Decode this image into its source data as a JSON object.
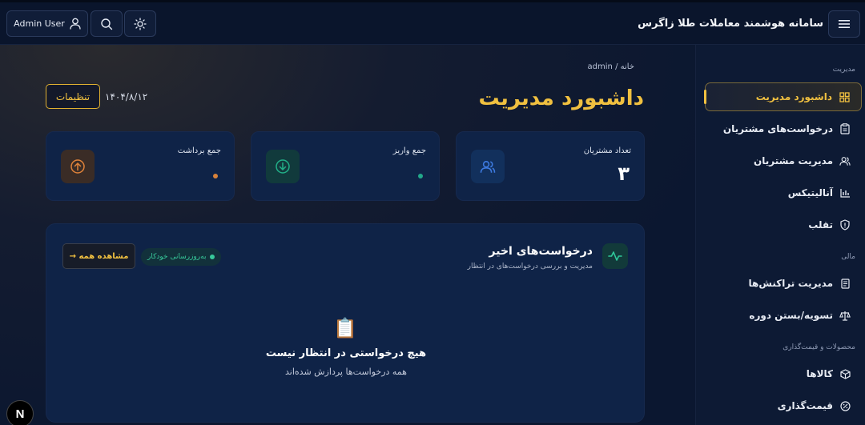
{
  "header": {
    "app_title": "سامانه هوشمند معاملات طلا زاگرس",
    "user_label": "Admin User"
  },
  "sidebar": {
    "sections": [
      {
        "label": "مدیریت"
      },
      {
        "label": "مالی"
      },
      {
        "label": "محصولات و قیمت‌گذاری"
      }
    ],
    "items": [
      {
        "label": "داشبورد مدیریت",
        "icon": "grid-icon",
        "active": true
      },
      {
        "label": "درخواست‌های مشتریان",
        "icon": "clipboard-icon"
      },
      {
        "label": "مدیریت مشتریان",
        "icon": "users-icon"
      },
      {
        "label": "آنالیتیکس",
        "icon": "bar-chart-icon"
      },
      {
        "label": "تقلب",
        "icon": "shield-icon"
      },
      {
        "label": "مدیریت تراکنش‌ها",
        "icon": "receipt-icon"
      },
      {
        "label": "تسویه/بستن دوره",
        "icon": "scale-icon"
      },
      {
        "label": "کالاها",
        "icon": "box-icon"
      },
      {
        "label": "قیمت‌گذاری",
        "icon": "tag-icon"
      }
    ]
  },
  "main": {
    "breadcrumb": "خانه / admin",
    "title": "داشبورد مدیریت",
    "settings_label": "تنظیمات",
    "date": "۱۴۰۴/۸/۱۲",
    "cards": [
      {
        "label": "تعداد مشتریان",
        "value": "۳",
        "icon": "users-icon"
      },
      {
        "label": "جمع واریز",
        "value": "",
        "icon": "arrow-down-circle-icon",
        "dot_color": "#22a88a"
      },
      {
        "label": "جمع برداشت",
        "value": "",
        "icon": "arrow-up-circle-icon",
        "dot_color": "#d9823a"
      }
    ],
    "recent": {
      "title": "درخواست‌های اخیر",
      "subtitle": "مدیریت و بررسی درخواست‌های در انتظار",
      "auto_refresh": "به‌روزرسانی خودکار",
      "view_all": "مشاهده همه →",
      "empty_icon": "📋",
      "empty_title": "هیچ درخواستی در انتظار نیست",
      "empty_subtitle": "همه درخواست‌ها پردازش شده‌اند"
    }
  },
  "colors": {
    "accent": "#f0c040",
    "background": "#0b1730",
    "card": "#0f2347",
    "success": "#37c99a"
  },
  "dev_badge": "N"
}
